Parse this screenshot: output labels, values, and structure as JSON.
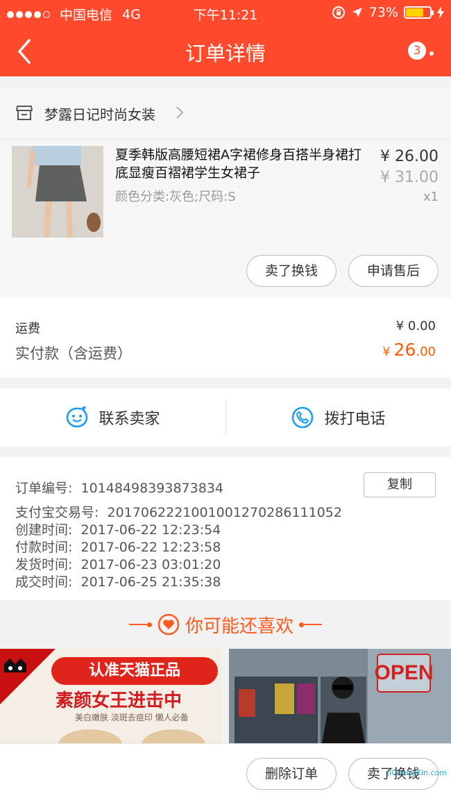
{
  "status_bar": {
    "carrier": "中国电信",
    "network": "4G",
    "time": "下午11:21",
    "battery_percent": "73%",
    "battery_level": 0.73
  },
  "nav": {
    "title": "订单详情",
    "badge_count": "3"
  },
  "shop": {
    "name": "梦露日记时尚女装"
  },
  "product": {
    "title": "夏季韩版高腰短裙A字裙修身百搭半身裙打底显瘦百褶裙学生女裙子",
    "sku": "颜色分类:灰色;尺码:S",
    "price": "¥ 26.00",
    "original_price": "¥ 31.00",
    "quantity": "x1",
    "buttons": [
      "卖了换钱",
      "申请售后"
    ]
  },
  "fees": {
    "shipping_label": "运费",
    "shipping_value": "¥ 0.00",
    "paid_label": "实付款（含运费）",
    "paid_currency": "¥ ",
    "paid_int": "26",
    "paid_dec": ".00"
  },
  "contact": {
    "seller": "联系卖家",
    "phone": "拨打电话"
  },
  "order_info": {
    "order_no_label": "订单编号:",
    "order_no": "10148498393873834",
    "copy": "复制",
    "alipay_label": "支付宝交易号:",
    "alipay_no": "2017062221001001270286111052",
    "created_label": "创建时间:",
    "created": "2017-06-22 12:23:54",
    "paid_label": "付款时间:",
    "paid": "2017-06-22 12:23:58",
    "shipped_label": "发货时间:",
    "shipped": "2017-06-23 03:01:20",
    "closed_label": "成交时间:",
    "closed": "2017-06-25 21:35:38"
  },
  "recommend": {
    "title": "你可能还喜欢",
    "ad_top": "认准天猫正品",
    "ad_main": "素颜女王进击中",
    "ad_sub": "美白嫩肤 淡斑去痘印 懒人必备",
    "open_sign": "OPEN"
  },
  "bottom": {
    "delete": "删除订单",
    "sell": "卖了换钱"
  },
  "watermark": "JiChengXin.com",
  "colors": {
    "brand": "#ff4a2d",
    "accent": "#ff5a1f",
    "contact_icon": "#1a9df0"
  }
}
